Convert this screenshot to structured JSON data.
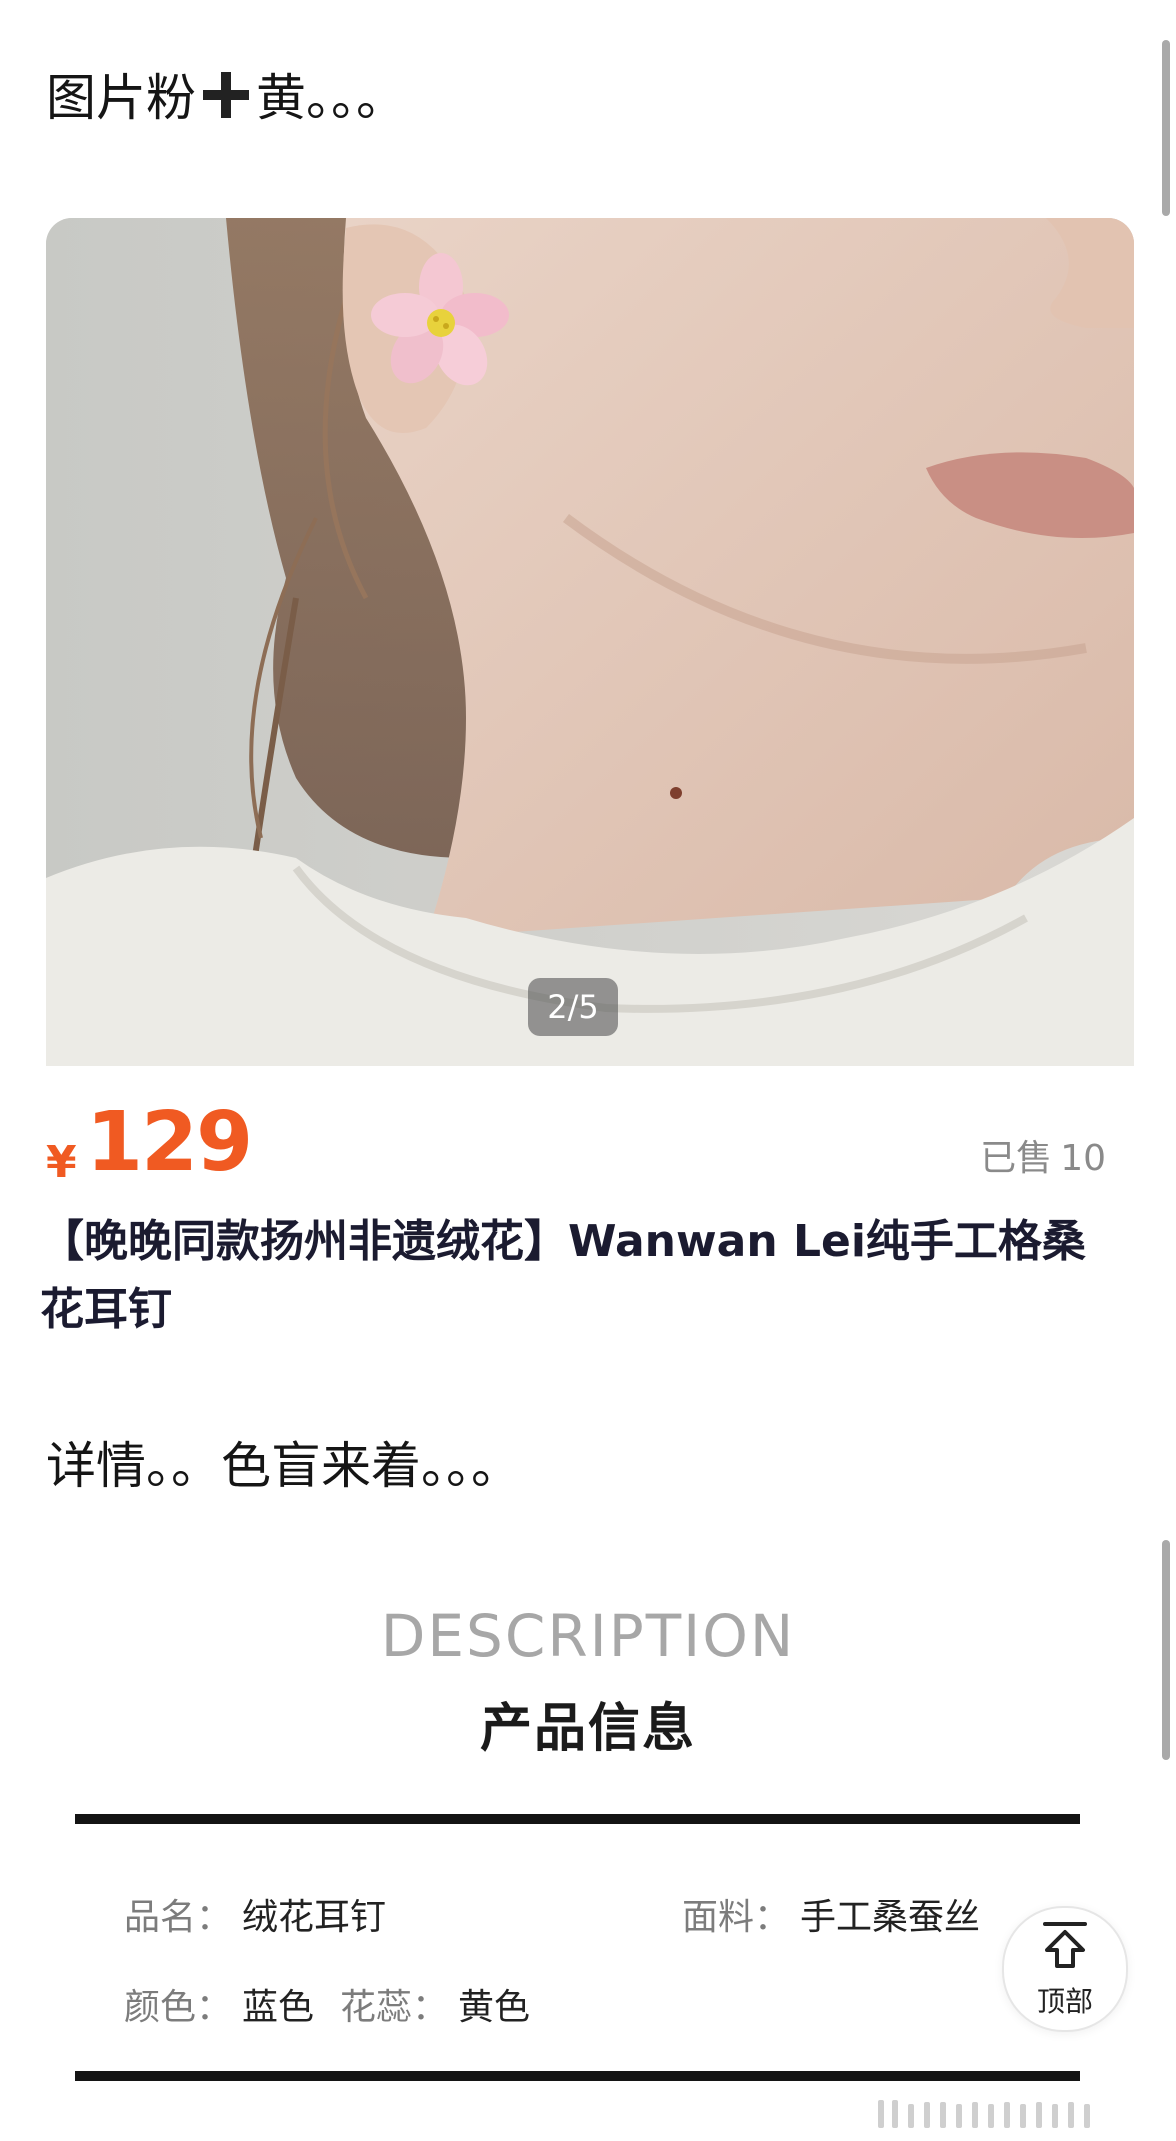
{
  "post": {
    "caption_top_a": "图片粉",
    "caption_top_b": "黄。。。",
    "caption_mid": "详情。。色盲来着。。。"
  },
  "gallery": {
    "page_indicator": "2/5"
  },
  "product": {
    "currency": "¥",
    "price": "129",
    "sold_label": "已售",
    "sold_count": "10",
    "title": "【晚晚同款扬州非遗绒花】Wanwan Lei纯手工格桑花耳钉"
  },
  "description": {
    "heading_en": "DESCRIPTION",
    "heading_cn": "产品信息",
    "specs": {
      "name_key": "品名",
      "name_value": "绒花耳钉",
      "material_key": "面料",
      "material_value": "手工桑蚕丝",
      "color_key": "颜色",
      "color_value": "蓝色",
      "stamen_key": "花蕊",
      "stamen_value": "黄色",
      "separator": "："
    }
  },
  "back_to_top": {
    "label": "顶部",
    "icon": "arrow-up-home-icon"
  },
  "colors": {
    "price": "#f05a22",
    "title": "#1b1b30",
    "muted": "#8a8a8a"
  }
}
